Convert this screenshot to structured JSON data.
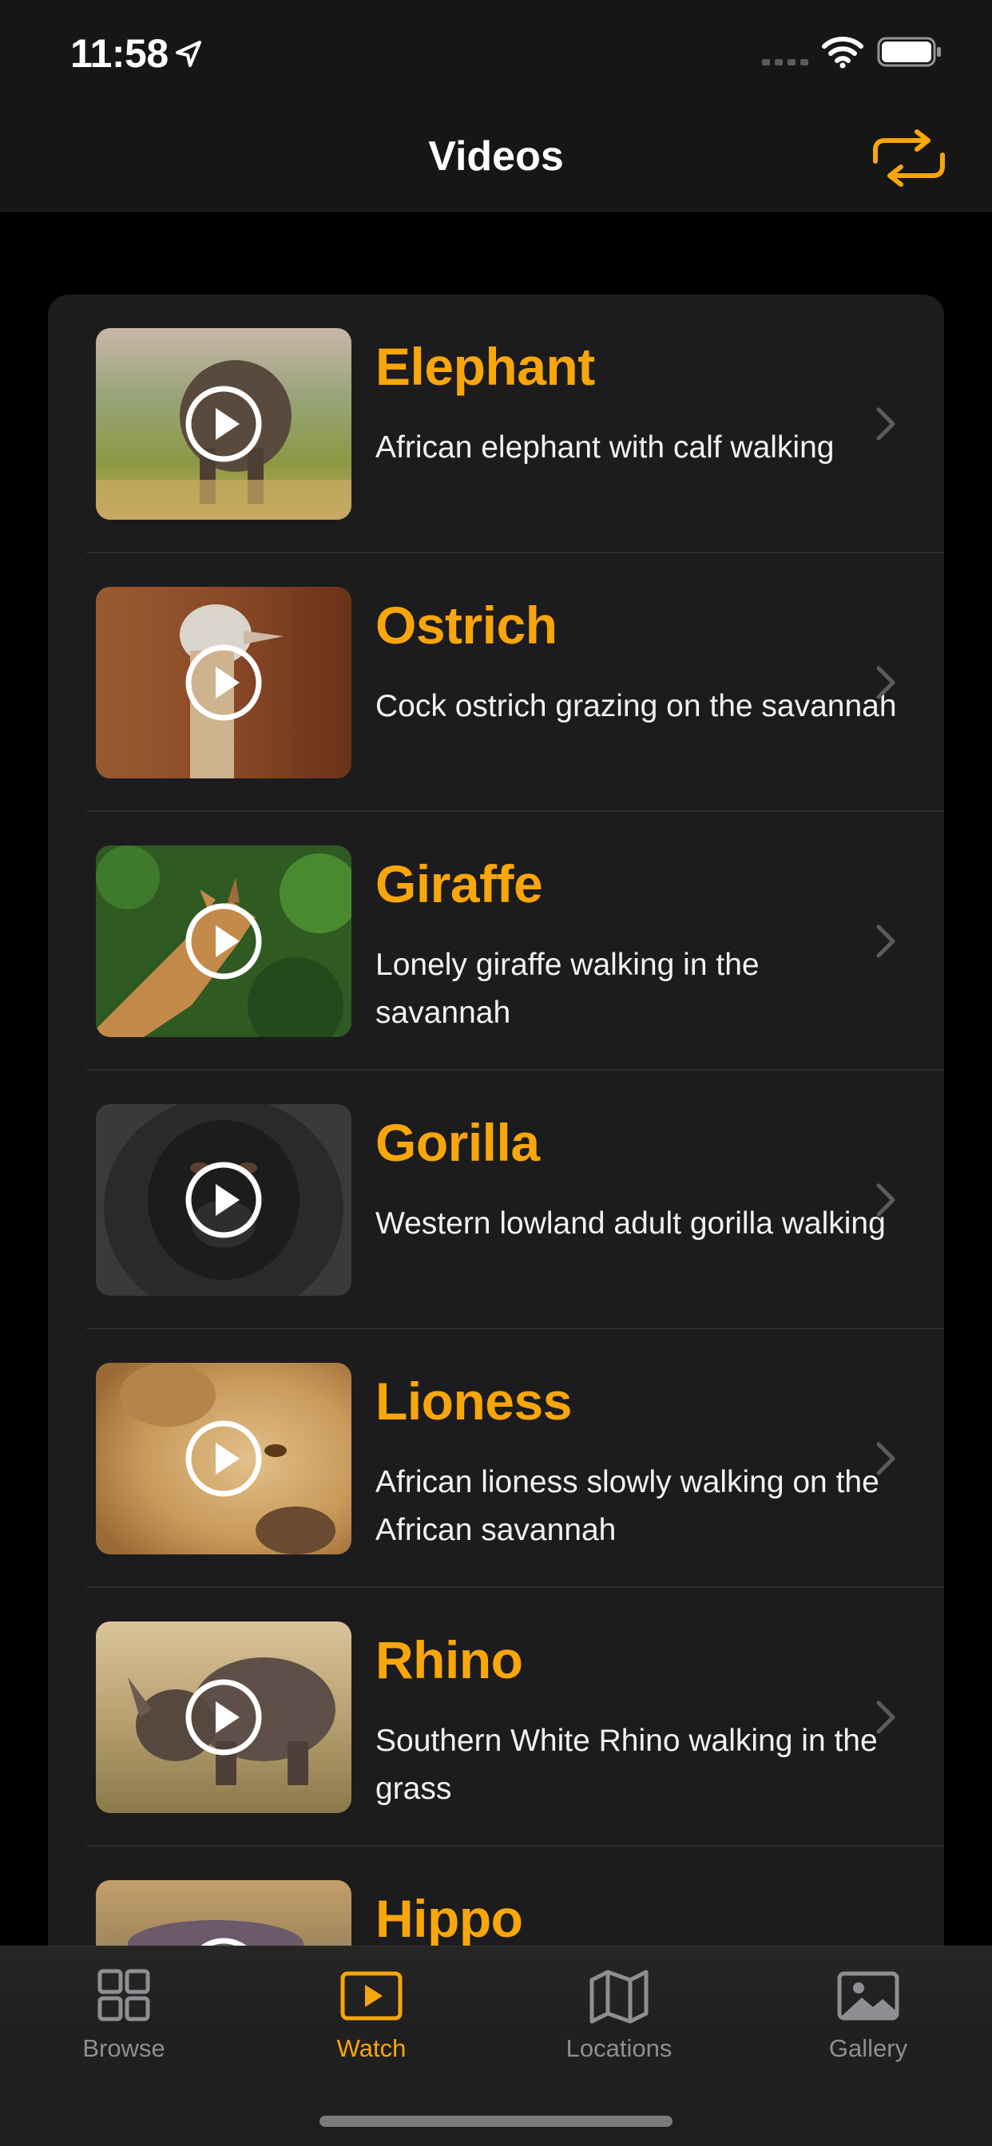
{
  "status_bar": {
    "time": "11:58"
  },
  "nav": {
    "title": "Videos",
    "action_icon": "repeat-icon"
  },
  "colors": {
    "accent": "#f9a60a",
    "background": "#000000",
    "card": "#1c1c1e",
    "bar": "#161616"
  },
  "videos": [
    {
      "title": "Elephant",
      "subtitle": "African elephant with calf walking"
    },
    {
      "title": "Ostrich",
      "subtitle": "Cock ostrich grazing on the savannah"
    },
    {
      "title": "Giraffe",
      "subtitle": "Lonely giraffe walking in the savannah"
    },
    {
      "title": "Gorilla",
      "subtitle": "Western lowland adult gorilla walking"
    },
    {
      "title": "Lioness",
      "subtitle": "African lioness slowly walking on the African savannah"
    },
    {
      "title": "Rhino",
      "subtitle": "Southern White Rhino walking in the grass"
    },
    {
      "title": "Hippo",
      "subtitle": ""
    }
  ],
  "tabs": [
    {
      "label": "Browse",
      "icon": "grid-icon",
      "active": false
    },
    {
      "label": "Watch",
      "icon": "play-rectangle-icon",
      "active": true
    },
    {
      "label": "Locations",
      "icon": "map-icon",
      "active": false
    },
    {
      "label": "Gallery",
      "icon": "photo-icon",
      "active": false
    }
  ]
}
